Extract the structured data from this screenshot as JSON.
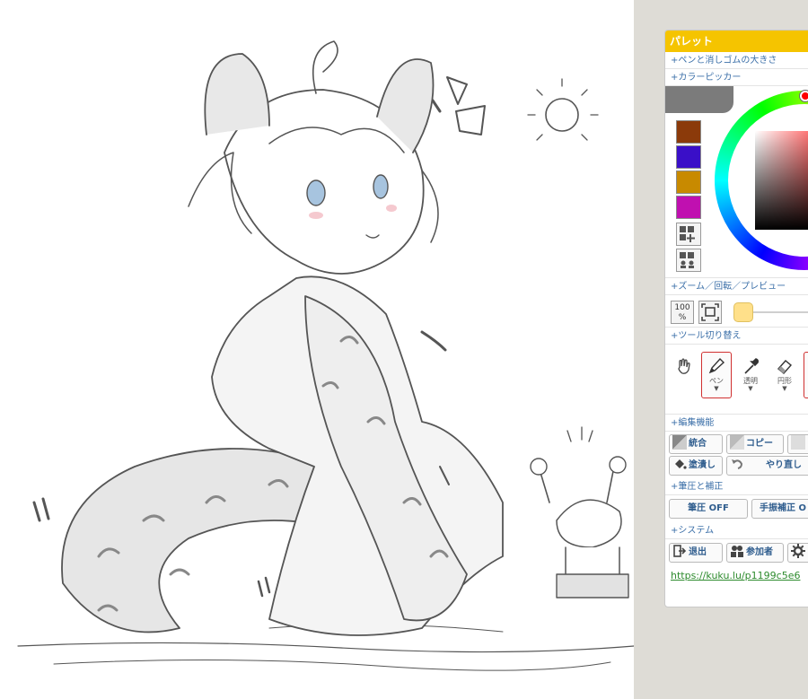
{
  "palette": {
    "title": "パレット",
    "sections": {
      "pen_eraser_size": "+ペンと消しゴムの大きさ",
      "color_picker": "+カラーピッカー",
      "zoom": "+ズーム／回転／プレビュー",
      "tool_switch": "+ツール切り替え",
      "edit": "+編集機能",
      "pressure": "+筆圧と補正",
      "system": "+システム"
    },
    "swatches": [
      "#8b3a0a",
      "#3a0fc8",
      "#c88a00",
      "#c010b0"
    ],
    "zoom_value": "100",
    "zoom_unit": "%",
    "slider_color": "#ffe08a",
    "tools": [
      {
        "label": "",
        "icon": "hand-icon"
      },
      {
        "label": "ペン",
        "icon": "pen-icon",
        "active": true
      },
      {
        "label": "透明",
        "icon": "dropper-icon"
      },
      {
        "label": "円形",
        "icon": "eraser-icon"
      }
    ],
    "edit_buttons": {
      "merge": "統合",
      "copy": "コピー",
      "fill": "塗潰し",
      "redo": "やり直し"
    },
    "pressure_buttons": {
      "pressure_off": "筆圧 OFF",
      "stabilizer": "手振補正 O"
    },
    "system_buttons": {
      "exit": "退出",
      "participants": "参加者"
    },
    "link": "https://kuku.lu/p1199c5e6"
  }
}
